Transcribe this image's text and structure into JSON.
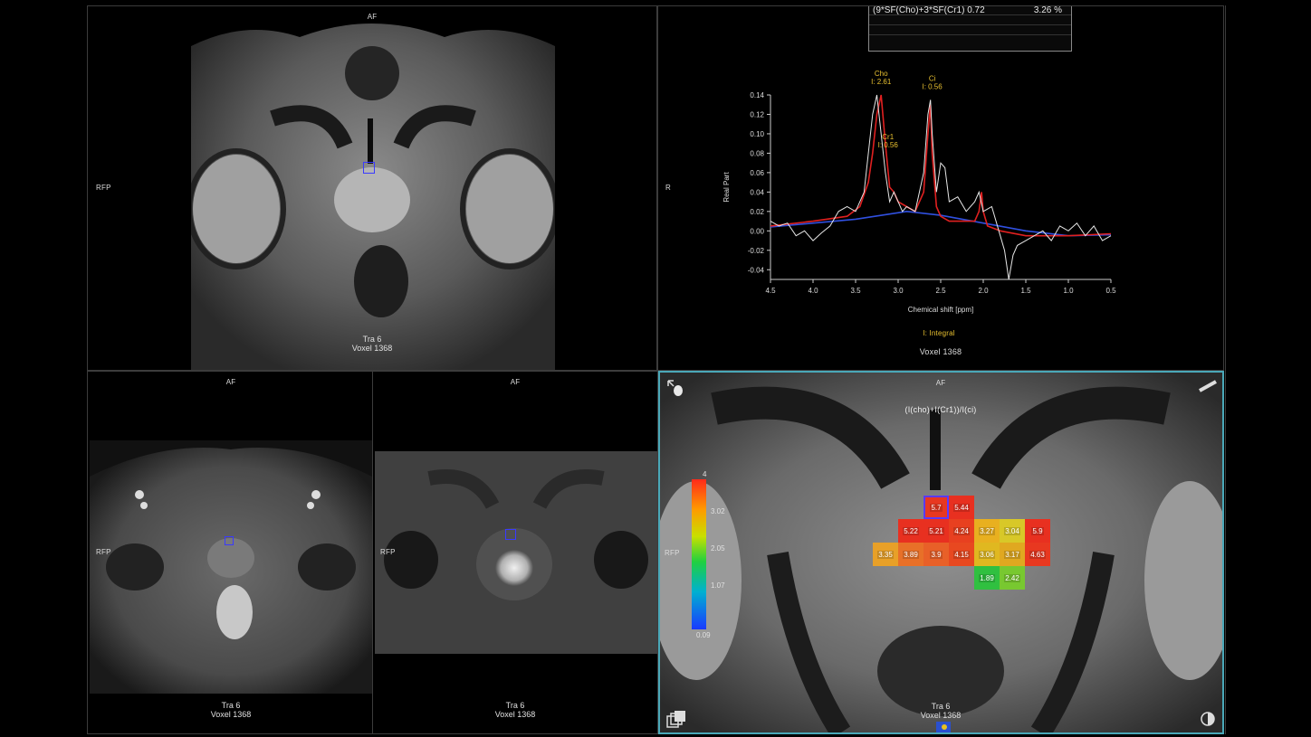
{
  "viewports": {
    "top_left": {
      "orient_top": "AF",
      "orient_left": "RFP",
      "foot_line1": "Tra 6",
      "foot_line2": "Voxel 1368"
    },
    "spectrum": {
      "orient_left": "R",
      "table_row1_label": "(9*SF(Cho)+3*SF(Cr1) 0.72",
      "table_row1_value": "3.26 %",
      "ylabel": "Real Part",
      "xlabel": "Chemical shift [ppm]",
      "legend": "I: Integral",
      "voxel": "Voxel 1368",
      "peaks": [
        {
          "name": "Cho",
          "integral": "I: 2.61"
        },
        {
          "name": "Cr1",
          "integral": "I: 0.56"
        },
        {
          "name": "Ci",
          "integral": "I: 0.56"
        }
      ]
    },
    "bottom_left": {
      "orient_top": "AF",
      "orient_left": "RFP",
      "foot_line1": "Tra 6",
      "foot_line2": "Voxel 1368"
    },
    "bottom_mid": {
      "orient_top": "AF",
      "orient_left": "RFP",
      "foot_line1": "Tra 6",
      "foot_line2": "Voxel 1368"
    },
    "bottom_right": {
      "orient_top": "AF",
      "orient_left": "RFP",
      "formula": "(I(cho)+I(Cr1))/I(ci)",
      "foot_line1": "Tra 6",
      "foot_line2": "Voxel 1368",
      "colorbar": {
        "max": "4",
        "t1": "3.02",
        "t2": "2.05",
        "t3": "1.07",
        "min": "0.09"
      }
    }
  },
  "chart_data": {
    "type": "line",
    "xlabel": "Chemical shift [ppm]",
    "ylabel": "Real Part",
    "xlim": [
      4.5,
      0.5
    ],
    "ylim": [
      -0.05,
      0.14
    ],
    "x_ticks": [
      "4.5",
      "4.0",
      "3.5",
      "3.0",
      "2.5",
      "2.0",
      "1.5",
      "1.0",
      "0.5"
    ],
    "y_ticks": [
      "0.14",
      "0.12",
      "0.10",
      "0.08",
      "0.06",
      "0.04",
      "0.02",
      "0.00",
      "-0.02",
      "-0.04"
    ],
    "series": [
      {
        "color": "#e6e6e6",
        "x": [
          4.5,
          4.4,
          4.3,
          4.2,
          4.1,
          4.0,
          3.9,
          3.8,
          3.7,
          3.6,
          3.5,
          3.4,
          3.35,
          3.3,
          3.25,
          3.2,
          3.15,
          3.1,
          3.05,
          3.0,
          2.95,
          2.9,
          2.8,
          2.7,
          2.65,
          2.62,
          2.6,
          2.55,
          2.5,
          2.45,
          2.4,
          2.3,
          2.2,
          2.1,
          2.05,
          2.0,
          1.9,
          1.8,
          1.75,
          1.7,
          1.65,
          1.6,
          1.5,
          1.4,
          1.3,
          1.2,
          1.1,
          1.0,
          0.9,
          0.8,
          0.7,
          0.6,
          0.5
        ],
        "y": [
          0.01,
          0.005,
          0.008,
          -0.005,
          0.0,
          -0.01,
          -0.002,
          0.005,
          0.02,
          0.025,
          0.02,
          0.04,
          0.08,
          0.12,
          0.14,
          0.1,
          0.06,
          0.03,
          0.04,
          0.03,
          0.02,
          0.025,
          0.02,
          0.06,
          0.12,
          0.135,
          0.1,
          0.04,
          0.07,
          0.065,
          0.03,
          0.035,
          0.02,
          0.03,
          0.04,
          0.02,
          0.025,
          -0.005,
          -0.02,
          -0.05,
          -0.025,
          -0.015,
          -0.01,
          -0.005,
          0.0,
          -0.01,
          0.005,
          0.0,
          0.008,
          -0.005,
          0.005,
          -0.01,
          -0.005
        ]
      },
      {
        "color": "#e02020",
        "x": [
          4.5,
          4.0,
          3.6,
          3.45,
          3.35,
          3.3,
          3.25,
          3.2,
          3.15,
          3.1,
          3.05,
          3.0,
          2.9,
          2.8,
          2.7,
          2.65,
          2.62,
          2.6,
          2.55,
          2.5,
          2.4,
          2.2,
          2.1,
          2.05,
          2.02,
          2.0,
          1.95,
          1.8,
          1.5,
          1.0,
          0.5
        ],
        "y": [
          0.005,
          0.01,
          0.015,
          0.025,
          0.05,
          0.08,
          0.12,
          0.14,
          0.09,
          0.045,
          0.04,
          0.03,
          0.025,
          0.02,
          0.04,
          0.1,
          0.13,
          0.08,
          0.025,
          0.015,
          0.01,
          0.01,
          0.01,
          0.02,
          0.04,
          0.02,
          0.005,
          0.0,
          -0.005,
          -0.005,
          -0.003
        ]
      },
      {
        "color": "#3050e0",
        "x": [
          4.5,
          3.5,
          2.9,
          2.5,
          2.0,
          1.5,
          1.0,
          0.5
        ],
        "y": [
          0.004,
          0.012,
          0.02,
          0.016,
          0.008,
          0.0,
          -0.005,
          -0.004
        ]
      }
    ]
  },
  "grid_cells": [
    {
      "v": "5.7",
      "c": "#e83820",
      "col": 2,
      "row": 0,
      "sel": true
    },
    {
      "v": "5.44",
      "c": "#e83020",
      "col": 3,
      "row": 0
    },
    {
      "v": "5.22",
      "c": "#e83020",
      "col": 1,
      "row": 1
    },
    {
      "v": "5.21",
      "c": "#e83020",
      "col": 2,
      "row": 1
    },
    {
      "v": "4.24",
      "c": "#e84020",
      "col": 3,
      "row": 1
    },
    {
      "v": "3.27",
      "c": "#e8b020",
      "col": 4,
      "row": 1
    },
    {
      "v": "3.04",
      "c": "#d8c828",
      "col": 5,
      "row": 1
    },
    {
      "v": "5.9",
      "c": "#e83020",
      "col": 6,
      "row": 1
    },
    {
      "v": "3.35",
      "c": "#e8a028",
      "col": 0,
      "row": 2
    },
    {
      "v": "3.89",
      "c": "#e87028",
      "col": 1,
      "row": 2
    },
    {
      "v": "3.9",
      "c": "#e86028",
      "col": 2,
      "row": 2
    },
    {
      "v": "4.15",
      "c": "#e84820",
      "col": 3,
      "row": 2
    },
    {
      "v": "3.06",
      "c": "#e0b820",
      "col": 4,
      "row": 2
    },
    {
      "v": "3.17",
      "c": "#e0a820",
      "col": 5,
      "row": 2
    },
    {
      "v": "4.63",
      "c": "#e83820",
      "col": 6,
      "row": 2
    },
    {
      "v": "1.89",
      "c": "#30c040",
      "col": 4,
      "row": 3
    },
    {
      "v": "2.42",
      "c": "#78c830",
      "col": 5,
      "row": 3
    }
  ]
}
